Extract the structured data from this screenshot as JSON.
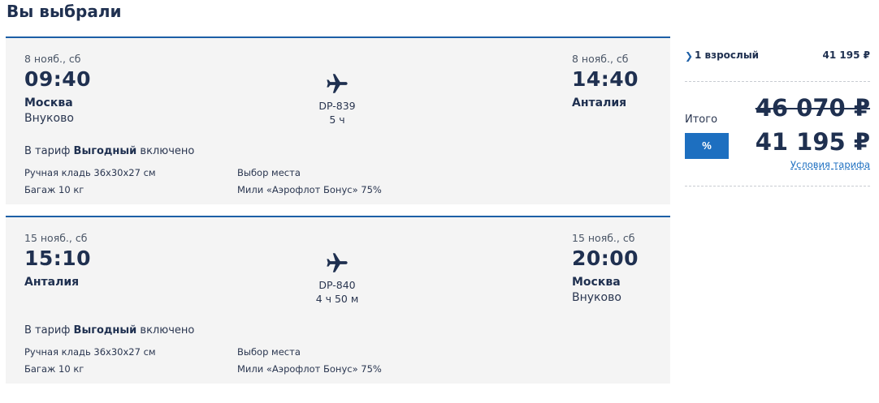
{
  "page": {
    "title": "Вы выбрали"
  },
  "colors": {
    "accent": "#1d5fa6",
    "button": "#1d6fc0",
    "text": "#1f3050",
    "card_bg": "#f4f4f4"
  },
  "flights": [
    {
      "departure": {
        "date": "8 нояб., сб",
        "time": "09:40",
        "city": "Москва",
        "airport": "Внуково"
      },
      "flight_number": "DP-839",
      "duration": "5 ч",
      "arrival": {
        "date": "8 нояб., сб",
        "time": "14:40",
        "city": "Анталия",
        "airport": ""
      },
      "tariff": {
        "prefix": "В тариф",
        "name": "Выгодный",
        "suffix": "включено"
      },
      "features": [
        "Ручная кладь 36x30x27 см",
        "Багаж 10 кг",
        "Выбор места",
        "Мили «Аэрофлот Бонус» 75%"
      ],
      "icon": "airplane-icon"
    },
    {
      "departure": {
        "date": "15 нояб., сб",
        "time": "15:10",
        "city": "Анталия",
        "airport": ""
      },
      "flight_number": "DP-840",
      "duration": "4 ч 50 м",
      "arrival": {
        "date": "15 нояб., сб",
        "time": "20:00",
        "city": "Москва",
        "airport": "Внуково"
      },
      "tariff": {
        "prefix": "В тариф",
        "name": "Выгодный",
        "suffix": "включено"
      },
      "features": [
        "Ручная кладь 36x30x27 см",
        "Багаж 10 кг",
        "Выбор места",
        "Мили «Аэрофлот Бонус» 75%"
      ],
      "icon": "airplane-icon"
    }
  ],
  "summary": {
    "passengers_label": "1 взрослый",
    "passengers_price": "41 195 ₽",
    "total_label": "Итого",
    "old_price": "46 070 ₽",
    "new_price": "41 195 ₽",
    "discount_button": "%",
    "fare_conditions_link": "Условия тарифа",
    "chevron_icon": "chevron-right-icon"
  }
}
